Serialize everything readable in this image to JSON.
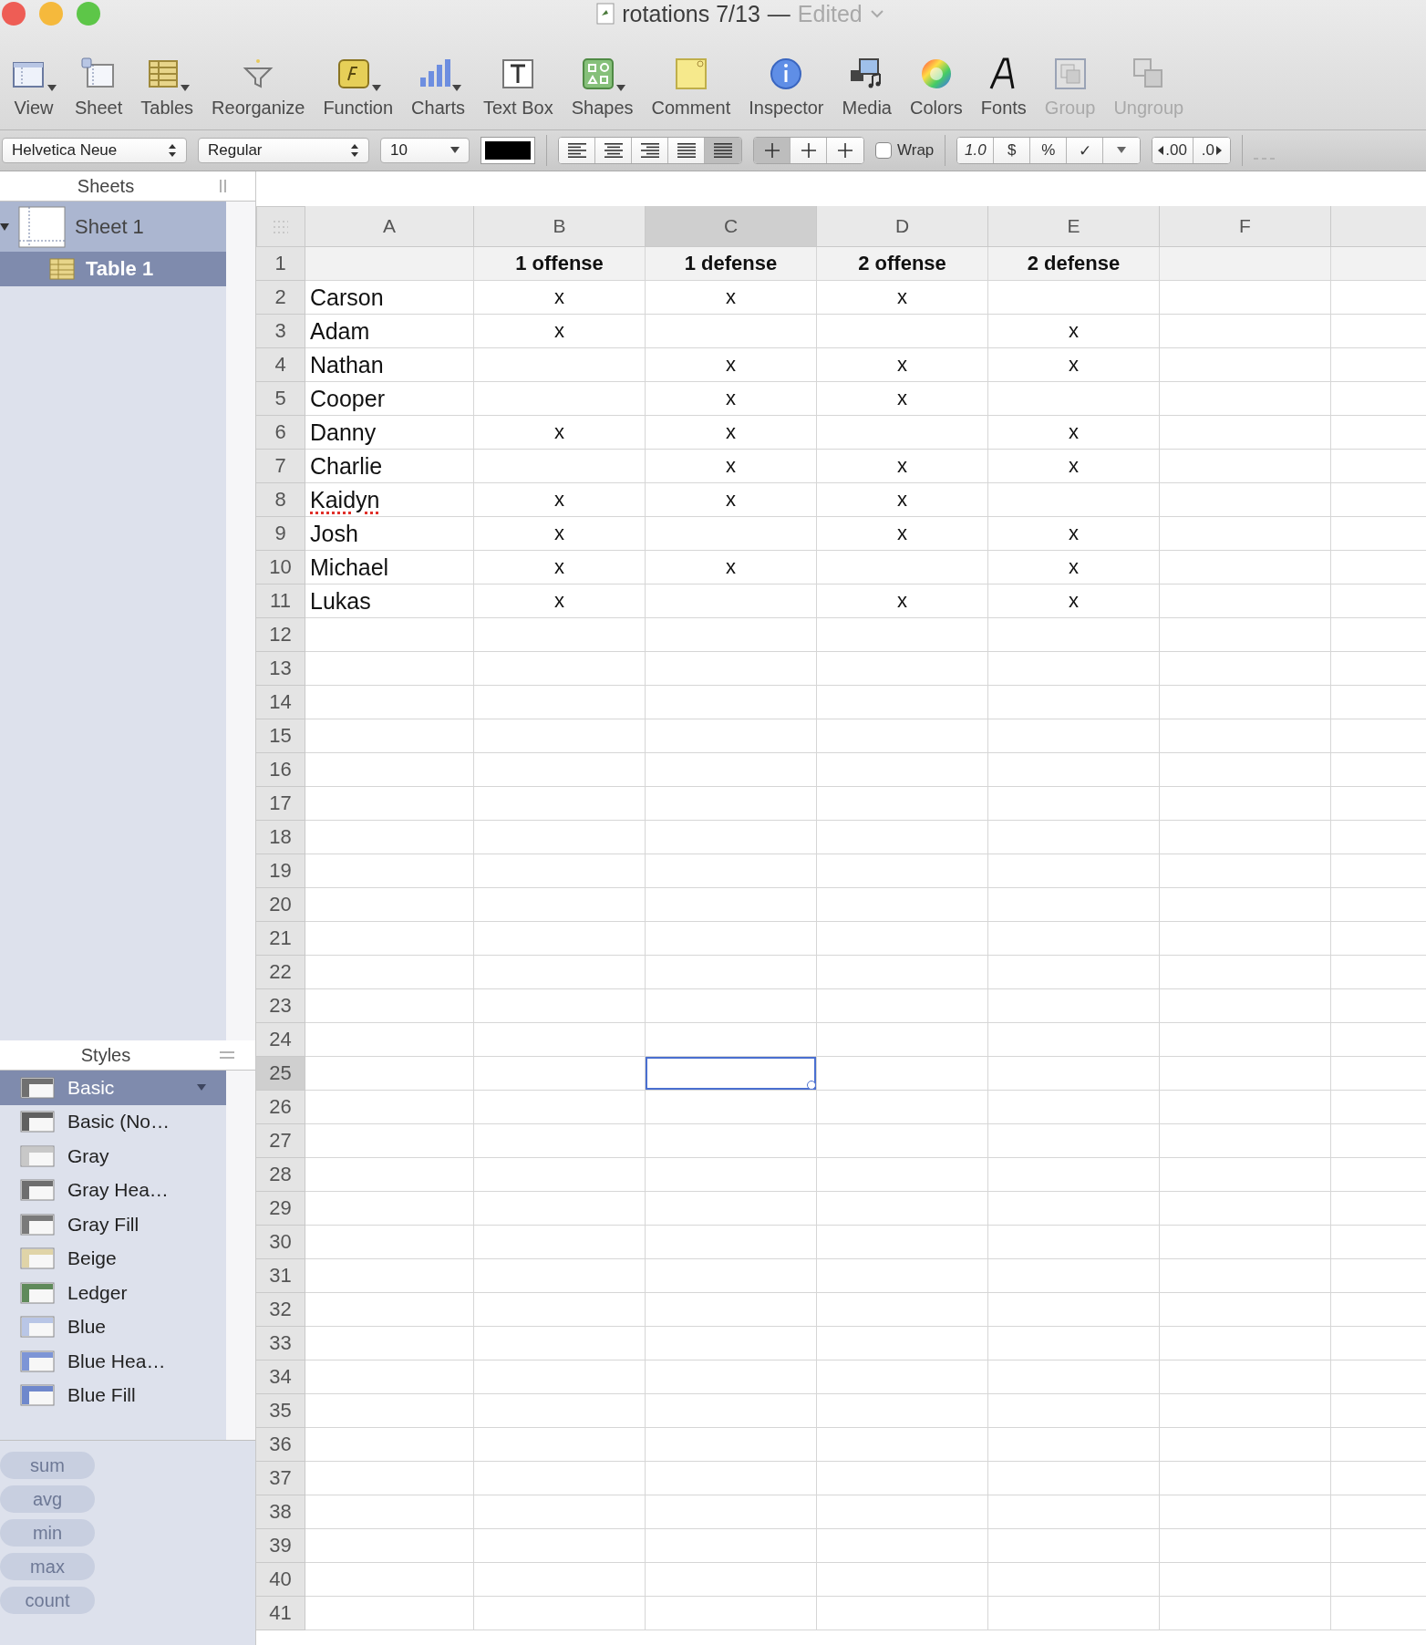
{
  "window": {
    "title": "rotations 7/13",
    "separator": "—",
    "status": "Edited"
  },
  "toolbar": [
    {
      "label": "View",
      "menu": true,
      "disabled": false
    },
    {
      "label": "Sheet",
      "menu": false,
      "disabled": false
    },
    {
      "label": "Tables",
      "menu": true,
      "disabled": false
    },
    {
      "label": "Reorganize",
      "menu": false,
      "disabled": false
    },
    {
      "label": "Function",
      "menu": true,
      "disabled": false
    },
    {
      "label": "Charts",
      "menu": true,
      "disabled": false
    },
    {
      "label": "Text Box",
      "menu": false,
      "disabled": false
    },
    {
      "label": "Shapes",
      "menu": true,
      "disabled": false
    },
    {
      "label": "Comment",
      "menu": false,
      "disabled": false
    },
    {
      "label": "Inspector",
      "menu": false,
      "disabled": false
    },
    {
      "label": "Media",
      "menu": false,
      "disabled": false
    },
    {
      "label": "Colors",
      "menu": false,
      "disabled": false
    },
    {
      "label": "Fonts",
      "menu": false,
      "disabled": false
    },
    {
      "label": "Group",
      "menu": false,
      "disabled": true
    },
    {
      "label": "Ungroup",
      "menu": false,
      "disabled": true
    }
  ],
  "format_bar": {
    "font": "Helvetica Neue",
    "style": "Regular",
    "size": "10",
    "wrap": {
      "label": "Wrap",
      "checked": false
    },
    "number_formats": [
      "1.0",
      "$",
      "%",
      "✓"
    ],
    "decimals": [
      ".00",
      ".0"
    ]
  },
  "sheets": {
    "title": "Sheets",
    "items": [
      {
        "label": "Sheet 1",
        "expanded": true,
        "selected": false,
        "children": [
          {
            "label": "Table 1",
            "selected": true
          }
        ]
      }
    ]
  },
  "styles": {
    "title": "Styles",
    "items": [
      {
        "label": "Basic",
        "selected": true,
        "color": "#707070"
      },
      {
        "label": "Basic (No…",
        "selected": false,
        "color": "#606060"
      },
      {
        "label": "Gray",
        "selected": false,
        "color": "#c8c8c8"
      },
      {
        "label": "Gray Hea…",
        "selected": false,
        "color": "#6e6e6e"
      },
      {
        "label": "Gray Fill",
        "selected": false,
        "color": "#7a7a7a"
      },
      {
        "label": "Beige",
        "selected": false,
        "color": "#e0d4a8"
      },
      {
        "label": "Ledger",
        "selected": false,
        "color": "#5f8a5a"
      },
      {
        "label": "Blue",
        "selected": false,
        "color": "#b9c6e6"
      },
      {
        "label": "Blue Hea…",
        "selected": false,
        "color": "#7d95d6"
      },
      {
        "label": "Blue Fill",
        "selected": false,
        "color": "#6f88cc"
      }
    ]
  },
  "stats": [
    {
      "label": "sum"
    },
    {
      "label": "avg"
    },
    {
      "label": "min"
    },
    {
      "label": "max"
    },
    {
      "label": "count"
    }
  ],
  "table": {
    "columns": [
      {
        "label": "A",
        "selected": false
      },
      {
        "label": "B",
        "selected": false
      },
      {
        "label": "C",
        "selected": true
      },
      {
        "label": "D",
        "selected": false
      },
      {
        "label": "E",
        "selected": false
      },
      {
        "label": "F",
        "selected": false
      }
    ],
    "rows": [
      {
        "number": "1",
        "kind": "header",
        "selected": false,
        "cells": [
          null,
          "1 offense",
          "1 defense",
          "2 offense",
          "2 defense",
          null
        ]
      },
      {
        "number": "2",
        "kind": "body",
        "selected": false,
        "cells": [
          "Carson",
          "x",
          "x",
          "x",
          null,
          null
        ]
      },
      {
        "number": "3",
        "kind": "body",
        "selected": false,
        "cells": [
          "Adam",
          "x",
          null,
          null,
          "x",
          null
        ]
      },
      {
        "number": "4",
        "kind": "body",
        "selected": false,
        "cells": [
          "Nathan",
          null,
          "x",
          "x",
          "x",
          null
        ]
      },
      {
        "number": "5",
        "kind": "body",
        "selected": false,
        "cells": [
          "Cooper",
          null,
          "x",
          "x",
          null,
          null
        ]
      },
      {
        "number": "6",
        "kind": "body",
        "selected": false,
        "cells": [
          "Danny",
          "x",
          "x",
          null,
          "x",
          null
        ]
      },
      {
        "number": "7",
        "kind": "body",
        "selected": false,
        "cells": [
          "Charlie",
          null,
          "x",
          "x",
          "x",
          null
        ]
      },
      {
        "number": "8",
        "kind": "body",
        "selected": false,
        "misspelled": true,
        "cells": [
          "Kaidyn",
          "x",
          "x",
          "x",
          null,
          null
        ]
      },
      {
        "number": "9",
        "kind": "body",
        "selected": false,
        "cells": [
          "Josh",
          "x",
          null,
          "x",
          "x",
          null
        ]
      },
      {
        "number": "10",
        "kind": "body",
        "selected": false,
        "cells": [
          "Michael",
          "x",
          "x",
          null,
          "x",
          null
        ]
      },
      {
        "number": "11",
        "kind": "body",
        "selected": false,
        "cells": [
          "Lukas",
          "x",
          null,
          "x",
          "x",
          null
        ]
      },
      {
        "number": "12",
        "selected": false
      },
      {
        "number": "13",
        "selected": false
      },
      {
        "number": "14",
        "selected": false
      },
      {
        "number": "15",
        "selected": false
      },
      {
        "number": "16",
        "selected": false
      },
      {
        "number": "17",
        "selected": false
      },
      {
        "number": "18",
        "selected": false
      },
      {
        "number": "19",
        "selected": false
      },
      {
        "number": "20",
        "selected": false
      },
      {
        "number": "21",
        "selected": false
      },
      {
        "number": "22",
        "selected": false
      },
      {
        "number": "23",
        "selected": false
      },
      {
        "number": "24",
        "selected": false
      },
      {
        "number": "25",
        "selected": true
      },
      {
        "number": "26",
        "selected": false
      },
      {
        "number": "27",
        "selected": false
      },
      {
        "number": "28",
        "selected": false
      },
      {
        "number": "29",
        "selected": false
      },
      {
        "number": "30",
        "selected": false
      },
      {
        "number": "31",
        "selected": false
      },
      {
        "number": "32",
        "selected": false
      },
      {
        "number": "33",
        "selected": false
      },
      {
        "number": "34",
        "selected": false
      },
      {
        "number": "35",
        "selected": false
      },
      {
        "number": "36",
        "selected": false
      },
      {
        "number": "37",
        "selected": false
      },
      {
        "number": "38",
        "selected": false
      },
      {
        "number": "39",
        "selected": false
      },
      {
        "number": "40",
        "selected": false
      },
      {
        "number": "41",
        "selected": false
      }
    ]
  }
}
